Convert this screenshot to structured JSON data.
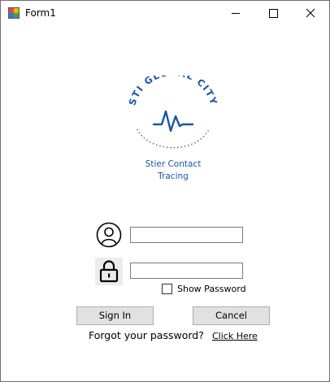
{
  "window": {
    "title": "Form1",
    "app_icon": "winforms-form-icon",
    "controls": {
      "minimize": "minimize-icon",
      "maximize": "maximize-icon",
      "close": "close-icon"
    }
  },
  "logo": {
    "arc_text": "STI GLOBAL CITY",
    "icon": "heartbeat-pulse-icon",
    "line1": "Stier Contact",
    "line2": "Tracing",
    "color": "#1a56a6"
  },
  "form": {
    "username_icon": "user-circle-icon",
    "username_value": "",
    "password_icon": "padlock-icon",
    "password_value": "",
    "show_password_label": "Show Password",
    "show_password_checked": false
  },
  "buttons": {
    "sign_in": "Sign In",
    "cancel": "Cancel"
  },
  "footer": {
    "forgot_text": "Forgot your password?",
    "link_text": "Click Here"
  }
}
